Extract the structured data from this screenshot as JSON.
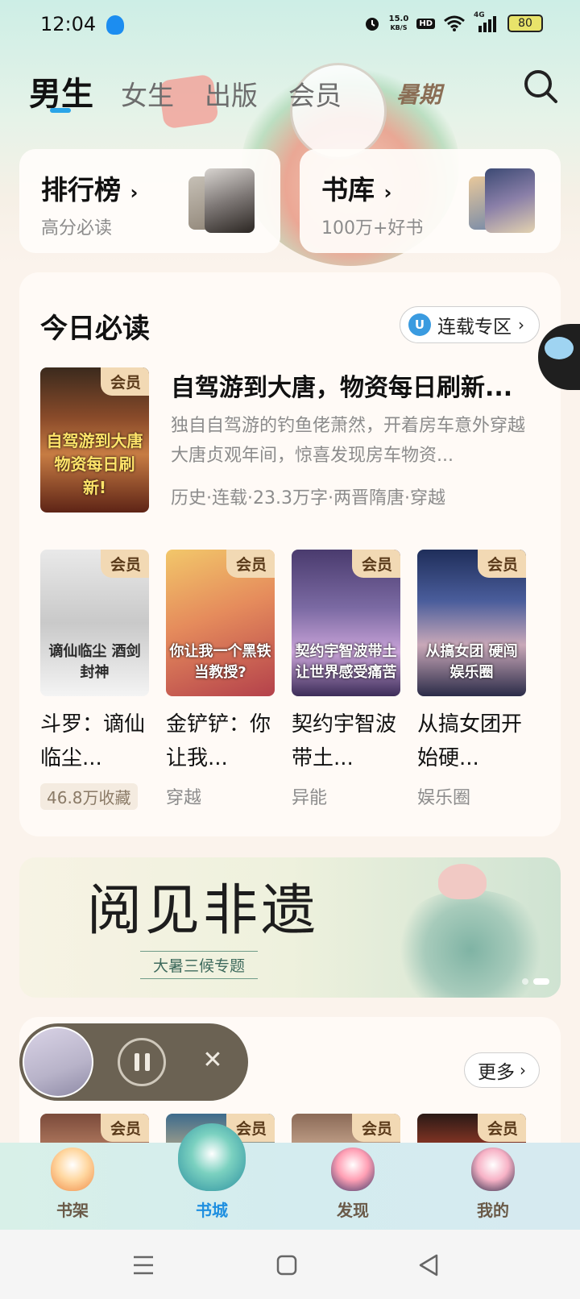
{
  "status_bar": {
    "time": "12:04",
    "net_speed_value": "15.0",
    "net_speed_unit": "KB/S",
    "hd": "HD",
    "network": "4G",
    "battery": "80"
  },
  "tabs": [
    {
      "label": "男生",
      "active": true
    },
    {
      "label": "女生"
    },
    {
      "label": "出版"
    },
    {
      "label": "会员"
    },
    {
      "label": "暑期"
    }
  ],
  "entries": {
    "rank": {
      "title": "排行榜",
      "sub": "高分必读"
    },
    "library": {
      "title": "书库",
      "sub": "100万+好书"
    }
  },
  "daily": {
    "title": "今日必读",
    "serial_pill": "连载专区",
    "featured": {
      "badge": "会员",
      "title": "自驾游到大唐，物资每日刷新...",
      "desc": "独自自驾游的钓鱼佬萧然，开着房车意外穿越大唐贞观年间，惊喜发现房车物资...",
      "meta": "历史·连载·23.3万字·两晋隋唐·穿越",
      "cover_text": "自驾游到大唐 物资每日刷新!"
    },
    "books": [
      {
        "badge": "会员",
        "title": "斗罗：谪仙临尘...",
        "tag": "46.8万收藏",
        "cover_text": "谪仙临尘 酒剑封神"
      },
      {
        "badge": "会员",
        "title": "金铲铲：你让我...",
        "tag": "穿越",
        "cover_text": "你让我一个黑铁当教授?"
      },
      {
        "badge": "会员",
        "title": "契约宇智波带土...",
        "tag": "异能",
        "cover_text": "契约宇智波带土 让世界感受痛苦"
      },
      {
        "badge": "会员",
        "title": "从搞女团开始硬...",
        "tag": "娱乐圈",
        "cover_text": "从搞女团 硬闯娱乐圈"
      }
    ]
  },
  "banner": {
    "calligraphy": "阅见非遗",
    "subtitle": "大暑三候专题"
  },
  "next_section": {
    "more": "更多",
    "badges": [
      "会员",
      "会员",
      "会员",
      "会员"
    ]
  },
  "bottom_nav": [
    {
      "label": "书架"
    },
    {
      "label": "书城",
      "active": true
    },
    {
      "label": "发现"
    },
    {
      "label": "我的"
    }
  ],
  "colors": {
    "accent_blue": "#2aa5e8",
    "vip_badge_bg": "#f2d9b4",
    "player_bg": "#6b6253",
    "page_bg": "#fbf3ec"
  }
}
